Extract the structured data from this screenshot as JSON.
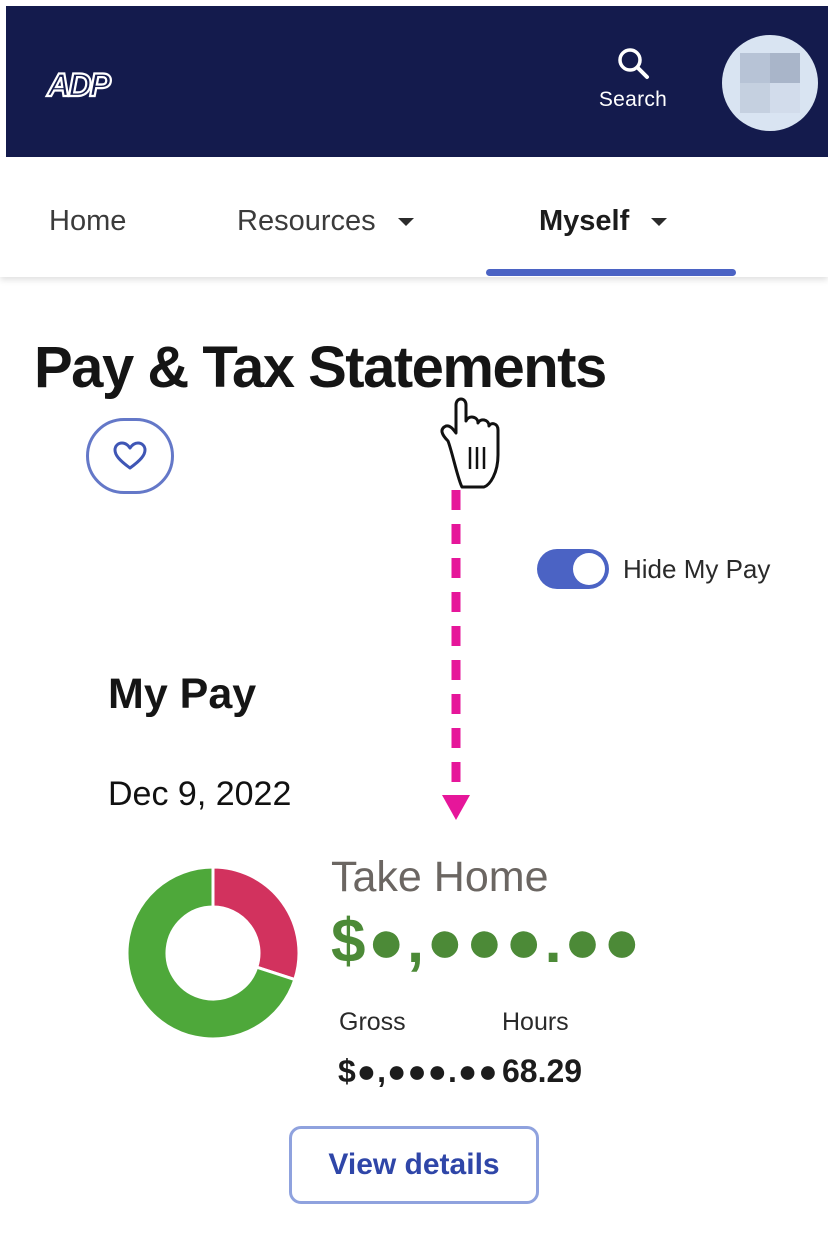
{
  "header": {
    "logo_text": "ADP",
    "search_label": "Search",
    "colors": {
      "background": "#141b4d",
      "text": "#ffffff"
    }
  },
  "nav": {
    "tabs": [
      {
        "label": "Home",
        "active": false,
        "has_dropdown": false
      },
      {
        "label": "Resources",
        "active": false,
        "has_dropdown": true
      },
      {
        "label": "Myself",
        "active": true,
        "has_dropdown": true
      }
    ],
    "active_color": "#4b63c4"
  },
  "page": {
    "title": "Pay & Tax Statements",
    "favorite_icon": "heart-icon"
  },
  "hide_pay_toggle": {
    "label": "Hide My Pay",
    "on": true
  },
  "my_pay": {
    "section_title": "My Pay",
    "date": "Dec 9, 2022",
    "take_home_label": "Take Home",
    "take_home_amount": "$●,●●●.●●",
    "gross_label": "Gross",
    "gross_amount": "$●,●●●.●●",
    "hours_label": "Hours",
    "hours_value": "68.29",
    "view_details_label": "View details",
    "chart_data": {
      "type": "pie",
      "donut": true,
      "title": "",
      "slices": [
        {
          "fraction": 0.7,
          "color": "#4ea83a"
        },
        {
          "fraction": 0.3,
          "color": "#d2325e"
        }
      ]
    }
  }
}
